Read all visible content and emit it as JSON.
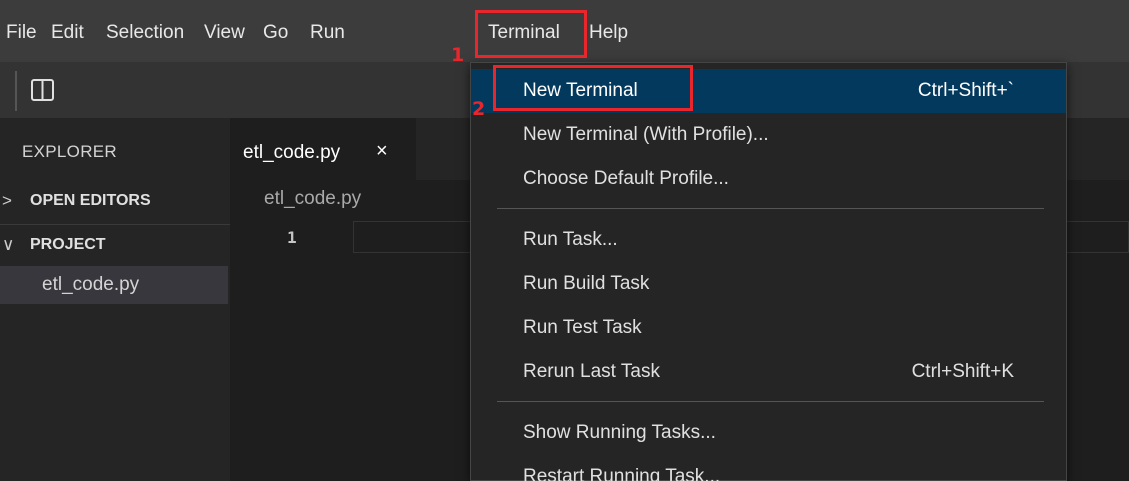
{
  "menubar": {
    "items": [
      "File",
      "Edit",
      "Selection",
      "View",
      "Go",
      "Run",
      "Terminal",
      "Help"
    ]
  },
  "toolbar": {
    "layout_icon": "split-layout-icon"
  },
  "sidebar": {
    "title": "EXPLORER",
    "sections": [
      {
        "chevron": ">",
        "label": "OPEN EDITORS"
      },
      {
        "chevron": "∨",
        "label": "PROJECT"
      }
    ],
    "file": "etl_code.py"
  },
  "editor": {
    "tab": {
      "name": "etl_code.py",
      "close": "×"
    },
    "breadcrumb": "etl_code.py",
    "line_number": "1"
  },
  "terminal_menu": {
    "items": [
      {
        "label": "New Terminal",
        "shortcut": "Ctrl+Shift+`"
      },
      {
        "label": "New Terminal (With Profile)...",
        "shortcut": ""
      },
      {
        "label": "Choose Default Profile...",
        "shortcut": ""
      },
      {
        "label": "Run Task...",
        "shortcut": ""
      },
      {
        "label": "Run Build Task",
        "shortcut": ""
      },
      {
        "label": "Run Test Task",
        "shortcut": ""
      },
      {
        "label": "Rerun Last Task",
        "shortcut": "Ctrl+Shift+K"
      },
      {
        "label": "Show Running Tasks...",
        "shortcut": ""
      },
      {
        "label": "Restart Running Task...",
        "shortcut": ""
      }
    ]
  },
  "annotations": {
    "step1": "1",
    "step2": "2"
  },
  "colors": {
    "menubar_bg": "#3c3c3c",
    "highlight": "#04395e",
    "annotation_red": "#e8262c"
  }
}
